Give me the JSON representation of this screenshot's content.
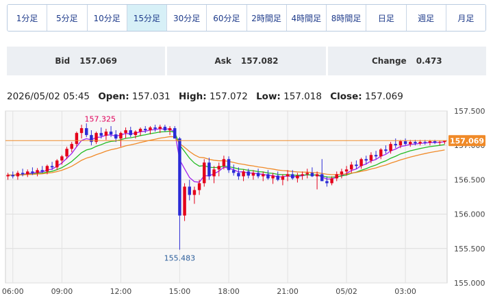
{
  "timeframes": [
    {
      "label": "1分足",
      "active": false
    },
    {
      "label": "5分足",
      "active": false
    },
    {
      "label": "10分足",
      "active": false
    },
    {
      "label": "15分足",
      "active": true
    },
    {
      "label": "30分足",
      "active": false
    },
    {
      "label": "60分足",
      "active": false
    },
    {
      "label": "2時間足",
      "active": false
    },
    {
      "label": "4時間足",
      "active": false
    },
    {
      "label": "8時間足",
      "active": false
    },
    {
      "label": "日足",
      "active": false
    },
    {
      "label": "週足",
      "active": false
    },
    {
      "label": "月足",
      "active": false
    }
  ],
  "quotes": {
    "bid_label": "Bid",
    "bid": "157.069",
    "ask_label": "Ask",
    "ask": "157.082",
    "change_label": "Change",
    "change": "0.473"
  },
  "ohlc": {
    "datetime": "2026/05/02 05:45",
    "open_label": "Open:",
    "open": "157.031",
    "high_label": "High:",
    "high": "157.072",
    "low_label": "Low:",
    "low": "157.018",
    "close_label": "Close:",
    "close": "157.069"
  },
  "colors": {
    "up": "#e4001a",
    "down": "#2b2bd6",
    "ma_short": "#a020f0",
    "ma_mid": "#22bb22",
    "ma_long": "#f08a28",
    "price_line": "#f08a28",
    "high_label": "#e0005a",
    "low_label": "#2b5d9a"
  },
  "chart_data": {
    "type": "candlestick",
    "y_ticks": [
      "157.500",
      "157.000",
      "156.500",
      "156.000",
      "155.500",
      "155.000"
    ],
    "ylim": [
      155.0,
      157.5
    ],
    "x_ticks": [
      "06:00",
      "09:00",
      "12:00",
      "15:00",
      "18:00",
      "21:00",
      "05/02",
      "03:00"
    ],
    "current_price": "157.069",
    "high_annotation": "157.325",
    "low_annotation": "155.483",
    "grid": true,
    "candles": [
      [
        156.55,
        156.6,
        156.5,
        156.57
      ],
      [
        156.57,
        156.62,
        156.52,
        156.55
      ],
      [
        156.55,
        156.63,
        156.5,
        156.6
      ],
      [
        156.6,
        156.66,
        156.55,
        156.58
      ],
      [
        156.58,
        156.65,
        156.54,
        156.62
      ],
      [
        156.62,
        156.68,
        156.57,
        156.6
      ],
      [
        156.6,
        156.67,
        156.55,
        156.64
      ],
      [
        156.64,
        156.7,
        156.6,
        156.62
      ],
      [
        156.62,
        156.72,
        156.58,
        156.7
      ],
      [
        156.7,
        156.76,
        156.64,
        156.68
      ],
      [
        156.68,
        156.8,
        156.64,
        156.78
      ],
      [
        156.78,
        156.86,
        156.72,
        156.84
      ],
      [
        156.84,
        156.98,
        156.8,
        156.95
      ],
      [
        156.95,
        157.05,
        156.9,
        157.02
      ],
      [
        157.02,
        157.2,
        156.98,
        157.18
      ],
      [
        157.18,
        157.3,
        157.1,
        157.25
      ],
      [
        157.25,
        157.32,
        157.12,
        157.15
      ],
      [
        157.15,
        157.22,
        157.0,
        157.05
      ],
      [
        157.05,
        157.2,
        157.02,
        157.18
      ],
      [
        157.18,
        157.26,
        157.1,
        157.14
      ],
      [
        157.14,
        157.24,
        157.08,
        157.2
      ],
      [
        157.2,
        157.28,
        157.12,
        157.16
      ],
      [
        157.16,
        157.22,
        157.05,
        157.1
      ],
      [
        157.1,
        157.2,
        156.98,
        157.18
      ],
      [
        157.18,
        157.26,
        157.1,
        157.22
      ],
      [
        157.22,
        157.27,
        157.12,
        157.15
      ],
      [
        157.15,
        157.22,
        157.1,
        157.2
      ],
      [
        157.2,
        157.26,
        157.14,
        157.24
      ],
      [
        157.24,
        157.28,
        157.18,
        157.22
      ],
      [
        157.22,
        157.28,
        157.16,
        157.26
      ],
      [
        157.26,
        157.3,
        157.2,
        157.24
      ],
      [
        157.24,
        157.3,
        157.18,
        157.27
      ],
      [
        157.27,
        157.3,
        157.2,
        157.22
      ],
      [
        157.22,
        157.28,
        157.15,
        157.25
      ],
      [
        157.25,
        157.28,
        157.1,
        157.1
      ],
      [
        157.1,
        157.12,
        155.483,
        155.98
      ],
      [
        155.98,
        156.45,
        155.9,
        156.4
      ],
      [
        156.4,
        156.5,
        156.2,
        156.28
      ],
      [
        156.28,
        156.4,
        156.15,
        156.35
      ],
      [
        156.35,
        156.5,
        156.28,
        156.45
      ],
      [
        156.45,
        156.8,
        156.4,
        156.75
      ],
      [
        156.75,
        156.82,
        156.5,
        156.55
      ],
      [
        156.55,
        156.7,
        156.45,
        156.65
      ],
      [
        156.65,
        156.75,
        156.55,
        156.7
      ],
      [
        156.7,
        156.85,
        156.65,
        156.8
      ],
      [
        156.8,
        156.84,
        156.6,
        156.64
      ],
      [
        156.64,
        156.72,
        156.56,
        156.6
      ],
      [
        156.6,
        156.68,
        156.5,
        156.55
      ],
      [
        156.55,
        156.65,
        156.48,
        156.62
      ],
      [
        156.62,
        156.66,
        156.52,
        156.56
      ],
      [
        156.56,
        156.64,
        156.5,
        156.6
      ],
      [
        156.6,
        156.66,
        156.52,
        156.55
      ],
      [
        156.55,
        156.62,
        156.48,
        156.58
      ],
      [
        156.58,
        156.64,
        156.5,
        156.52
      ],
      [
        156.52,
        156.6,
        156.44,
        156.56
      ],
      [
        156.56,
        156.62,
        156.48,
        156.5
      ],
      [
        156.5,
        156.58,
        156.42,
        156.55
      ],
      [
        156.55,
        156.64,
        156.48,
        156.58
      ],
      [
        156.58,
        156.64,
        156.5,
        156.52
      ],
      [
        156.52,
        156.6,
        156.46,
        156.56
      ],
      [
        156.56,
        156.62,
        156.5,
        156.58
      ],
      [
        156.58,
        156.66,
        156.52,
        156.6
      ],
      [
        156.6,
        156.68,
        156.54,
        156.55
      ],
      [
        156.55,
        156.62,
        156.36,
        156.58
      ],
      [
        156.58,
        156.8,
        156.54,
        156.48
      ],
      [
        156.48,
        156.55,
        156.4,
        156.45
      ],
      [
        156.45,
        156.55,
        156.42,
        156.52
      ],
      [
        156.52,
        156.62,
        156.48,
        156.58
      ],
      [
        156.58,
        156.66,
        156.52,
        156.62
      ],
      [
        156.62,
        156.7,
        156.56,
        156.65
      ],
      [
        156.65,
        156.76,
        156.6,
        156.72
      ],
      [
        156.72,
        156.78,
        156.66,
        156.7
      ],
      [
        156.7,
        156.82,
        156.66,
        156.8
      ],
      [
        156.8,
        156.85,
        156.72,
        156.78
      ],
      [
        156.78,
        156.9,
        156.74,
        156.86
      ],
      [
        156.86,
        156.92,
        156.8,
        156.84
      ],
      [
        156.84,
        156.96,
        156.8,
        156.94
      ],
      [
        156.94,
        157.0,
        156.88,
        156.92
      ],
      [
        156.92,
        157.05,
        156.88,
        157.02
      ],
      [
        157.02,
        157.1,
        156.96,
        157.0
      ],
      [
        157.0,
        157.08,
        156.96,
        157.06
      ],
      [
        157.06,
        157.1,
        157.0,
        157.02
      ],
      [
        157.02,
        157.08,
        156.98,
        157.05
      ],
      [
        157.05,
        157.08,
        157.0,
        157.03
      ],
      [
        157.03,
        157.08,
        157.0,
        157.05
      ],
      [
        157.05,
        157.08,
        157.01,
        157.04
      ],
      [
        157.04,
        157.08,
        157.0,
        157.06
      ],
      [
        157.06,
        157.08,
        157.02,
        157.04
      ],
      [
        157.04,
        157.07,
        157.0,
        157.05
      ],
      [
        157.05,
        157.07,
        157.018,
        157.069
      ]
    ]
  }
}
